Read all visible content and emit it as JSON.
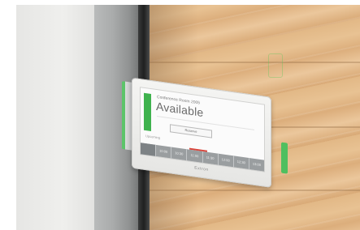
{
  "panel": {
    "room_name": "Conference Room 2005",
    "status": "Available",
    "reserve_button": "Reserve",
    "upcoming_label": "Upcoming",
    "timeline_slots": [
      "",
      "10:00",
      "10:30",
      "11:00",
      "11:30",
      "12:00",
      "12:30",
      "13:00"
    ],
    "brand": "Extron"
  },
  "colors": {
    "available": "#3fb24e",
    "led": "#4fbf5f",
    "timeline": "#9a9ea0",
    "marker": "#d9453b"
  }
}
